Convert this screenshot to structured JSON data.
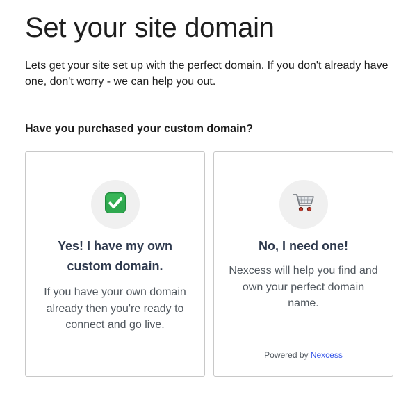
{
  "page": {
    "title": "Set your site domain",
    "intro": "Lets get your site set up with the perfect domain. If you don't already have one, don't worry - we can help you out.",
    "question": "Have you purchased your custom domain?"
  },
  "options": [
    {
      "icon": "check-mark-icon",
      "icon_color": "#2fa84f",
      "title": "Yes! I have my own custom domain.",
      "description": "If you have your own domain already then you're ready to connect and go live."
    },
    {
      "icon": "shopping-cart-icon",
      "title": "No, I need one!",
      "description": "Nexcess will help you find and own your perfect domain name.",
      "powered_by_prefix": "Powered by ",
      "powered_by_link": "Nexcess"
    }
  ],
  "colors": {
    "card_title": "#2f3a4e",
    "link": "#3858e9",
    "card_border": "#c8c8c8",
    "icon_circle": "#f0f0f0"
  }
}
